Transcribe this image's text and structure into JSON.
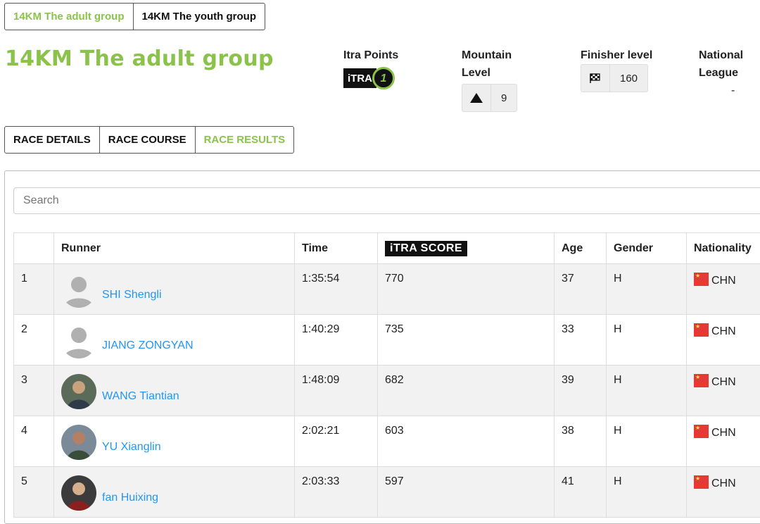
{
  "groups": {
    "active": "14KM The adult group",
    "other": "14KM The youth group"
  },
  "page_title": "14KM The adult group",
  "stats": {
    "itra_points": {
      "label": "Itra Points",
      "logo": "iTRA",
      "value": "1"
    },
    "mountain_level": {
      "label_1": "Mountain",
      "label_2": "Level",
      "icon": "mountain-icon",
      "value": "9"
    },
    "finisher_level": {
      "label": "Finisher level",
      "icon": "checkered-flag-icon",
      "value": "160"
    },
    "national_league": {
      "label_1": "National",
      "label_2": "League",
      "value": "-"
    }
  },
  "tabs": [
    "RACE DETAILS",
    "RACE COURSE",
    "RACE RESULTS"
  ],
  "search": {
    "placeholder": "Search"
  },
  "table": {
    "headers": {
      "rank": "",
      "runner": "Runner",
      "time": "Time",
      "score": "iTRA SCORE",
      "age": "Age",
      "gender": "Gender",
      "nationality": "Nationality"
    },
    "rows": [
      {
        "rank": "1",
        "runner": "SHI Shengli",
        "time": "1:35:54",
        "score": "770",
        "age": "37",
        "gender": "H",
        "nationality": "CHN",
        "avatar": "placeholder"
      },
      {
        "rank": "2",
        "runner": "JIANG ZONGYAN",
        "time": "1:40:29",
        "score": "735",
        "age": "33",
        "gender": "H",
        "nationality": "CHN",
        "avatar": "placeholder"
      },
      {
        "rank": "3",
        "runner": "WANG Tiantian",
        "time": "1:48:09",
        "score": "682",
        "age": "39",
        "gender": "H",
        "nationality": "CHN",
        "avatar": "photo"
      },
      {
        "rank": "4",
        "runner": "YU Xianglin",
        "time": "2:02:21",
        "score": "603",
        "age": "38",
        "gender": "H",
        "nationality": "CHN",
        "avatar": "photo"
      },
      {
        "rank": "5",
        "runner": "fan Huixing",
        "time": "2:03:33",
        "score": "597",
        "age": "41",
        "gender": "H",
        "nationality": "CHN",
        "avatar": "photo"
      }
    ]
  },
  "colors": {
    "accent": "#8bc34a",
    "link": "#2196f3",
    "flag_red": "#e53935"
  }
}
